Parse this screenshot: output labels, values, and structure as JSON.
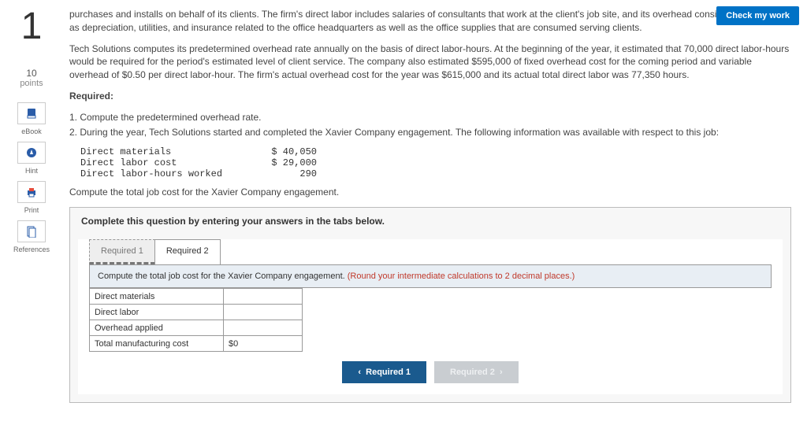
{
  "header": {
    "check_work": "Check my work"
  },
  "question": {
    "number": "1",
    "points_value": "10",
    "points_label": "points"
  },
  "sidebar": {
    "ebook": "eBook",
    "hint": "Hint",
    "print": "Print",
    "references": "References"
  },
  "body": {
    "p1": "purchases and installs on behalf of its clients. The firm's direct labor includes salaries of consultants that work at the client's job site, and its overhead consists of costs such as depreciation, utilities, and insurance related to the office headquarters as well as the office supplies that are consumed serving clients.",
    "p2": "Tech Solutions computes its predetermined overhead rate annually on the basis of direct labor-hours. At the beginning of the year, it estimated that 70,000 direct labor-hours would be required for the period's estimated level of client service. The company also estimated $595,000 of fixed overhead cost for the coming period and variable overhead of $0.50 per direct labor-hour. The firm's actual overhead cost for the year was $615,000 and its actual total direct labor was 77,350 hours.",
    "required_label": "Required:",
    "r1": "1. Compute the predetermined overhead rate.",
    "r2": "2. During the year, Tech Solutions started and completed the Xavier Company engagement. The following information was available with respect to this job:",
    "jobdata": {
      "dm_label": "Direct materials",
      "dm_val": "$ 40,050",
      "dl_label": "Direct labor cost",
      "dl_val": "$ 29,000",
      "dlh_label": "Direct labor-hours worked",
      "dlh_val": "290"
    },
    "p3": "Compute the total job cost for the Xavier Company engagement."
  },
  "answerbox": {
    "instr": "Complete this question by entering your answers in the tabs below.",
    "tab1": "Required 1",
    "tab2": "Required 2",
    "panel_text": "Compute the total job cost for the Xavier Company engagement. ",
    "panel_hint": "(Round your intermediate calculations to 2 decimal places.)",
    "rows": {
      "dm": "Direct materials",
      "dl": "Direct labor",
      "oh": "Overhead applied",
      "tot": "Total manufacturing cost",
      "cur": "$",
      "tot_val": "0"
    },
    "nav_prev": "Required 1",
    "nav_next": "Required 2"
  }
}
